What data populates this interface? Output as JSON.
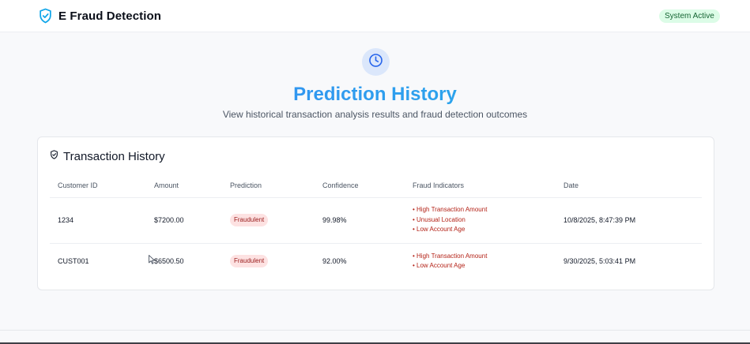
{
  "header": {
    "title": "E Fraud Detection",
    "status": "System Active",
    "logo_icon": "shield-check-icon"
  },
  "hero": {
    "icon": "clock-icon",
    "title": "Prediction History",
    "subtitle": "View historical transaction analysis results and fraud detection outcomes"
  },
  "history": {
    "title": "Transaction History",
    "title_icon": "shield-check-icon",
    "columns": [
      "Customer ID",
      "Amount",
      "Prediction",
      "Confidence",
      "Fraud Indicators",
      "Date"
    ],
    "rows": [
      {
        "customer_id": "1234",
        "amount": "$7200.00",
        "prediction": "Fraudulent",
        "confidence": "99.98%",
        "indicators": [
          "High Transaction Amount",
          "Unusual Location",
          "Low Account Age"
        ],
        "date": "10/8/2025, 8:47:39 PM"
      },
      {
        "customer_id": "CUST001",
        "amount": "$6500.50",
        "prediction": "Fraudulent",
        "confidence": "92.00%",
        "indicators": [
          "High Transaction Amount",
          "Low Account Age"
        ],
        "date": "9/30/2025, 5:03:41 PM"
      }
    ]
  },
  "colors": {
    "accent_blue": "#3b82f6",
    "accent_cyan": "#22b8e6",
    "status_green_bg": "#dcfce7",
    "status_green_text": "#166534",
    "fraud_badge_bg": "#fde2e2",
    "fraud_text": "#b42318"
  }
}
